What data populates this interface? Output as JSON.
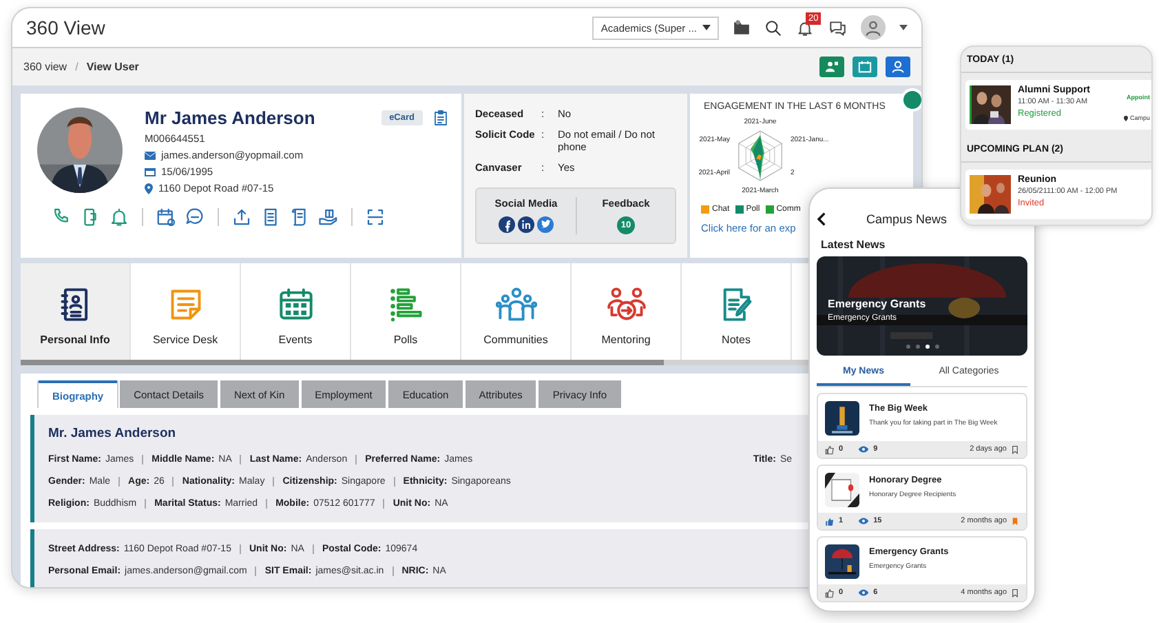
{
  "window": {
    "title": "360 View"
  },
  "header": {
    "role_select": "Academics (Super ...",
    "notification_count": "20"
  },
  "breadcrumb": {
    "items": [
      "360 view",
      "View User"
    ],
    "separator": "/"
  },
  "profile": {
    "name": "Mr James Anderson",
    "id": "M006644551",
    "email": "james.anderson@yopmail.com",
    "dob": "15/06/1995",
    "address": "1160 Depot Road #07-15",
    "ecard": "eCard"
  },
  "status_fields": [
    {
      "label": "Deceased",
      "sep": ":",
      "value": "No"
    },
    {
      "label": "Solicit Code",
      "sep": ":",
      "value": "Do not email / Do not phone"
    },
    {
      "label": "Canvaser",
      "sep": ":",
      "value": "Yes"
    }
  ],
  "social": {
    "title": "Social Media"
  },
  "feedback": {
    "title": "Feedback",
    "count": "10"
  },
  "engagement": {
    "title": "ENGAGEMENT IN THE LAST 6 MONTHS",
    "axes": [
      "2021-June",
      "2021-Janu...",
      "2",
      "2021-March",
      "2021-April",
      "2021-May"
    ],
    "legend": [
      {
        "label": "Chat",
        "color": "#f39c12"
      },
      {
        "label": "Poll",
        "color": "#148a68"
      },
      {
        "label": "Comm",
        "color": "#23a23a"
      }
    ],
    "link": "Click here for an exp"
  },
  "modules": [
    {
      "label": "Personal Info",
      "selected": true
    },
    {
      "label": "Service Desk",
      "selected": false
    },
    {
      "label": "Events",
      "selected": false
    },
    {
      "label": "Polls",
      "selected": false
    },
    {
      "label": "Communities",
      "selected": false
    },
    {
      "label": "Mentoring",
      "selected": false
    },
    {
      "label": "Notes",
      "selected": false
    }
  ],
  "tabs": [
    {
      "label": "Biography",
      "selected": true
    },
    {
      "label": "Contact Details",
      "selected": false
    },
    {
      "label": "Next of Kin",
      "selected": false
    },
    {
      "label": "Employment",
      "selected": false
    },
    {
      "label": "Education",
      "selected": false
    },
    {
      "label": "Attributes",
      "selected": false
    },
    {
      "label": "Privacy Info",
      "selected": false
    }
  ],
  "biography": {
    "heading": "Mr. James Anderson",
    "rows": [
      [
        {
          "label": "First Name:",
          "value": "James"
        },
        {
          "label": "Middle Name:",
          "value": "NA"
        },
        {
          "label": "Last Name:",
          "value": "Anderson"
        },
        {
          "label": "Preferred Name:",
          "value": "James"
        }
      ],
      [
        {
          "label": "Gender:",
          "value": "Male"
        },
        {
          "label": "Age:",
          "value": "26"
        },
        {
          "label": "Nationality:",
          "value": "Malay"
        },
        {
          "label": "Citizenship:",
          "value": "Singapore"
        },
        {
          "label": "Ethnicity:",
          "value": "Singaporeans"
        }
      ],
      [
        {
          "label": "Religion:",
          "value": "Buddhism"
        },
        {
          "label": "Marital Status:",
          "value": "Married"
        },
        {
          "label": "Mobile:",
          "value": "07512 601777"
        },
        {
          "label": "Unit No:",
          "value": "NA"
        }
      ]
    ],
    "aside": {
      "label": "Title:",
      "value": "Se"
    }
  },
  "address": {
    "rows": [
      [
        {
          "label": "Street Address:",
          "value": "1160 Depot Road #07-15"
        },
        {
          "label": "Unit No:",
          "value": "NA"
        },
        {
          "label": "Postal Code:",
          "value": "109674"
        }
      ],
      [
        {
          "label": "Personal Email:",
          "value": "james.anderson@gmail.com"
        },
        {
          "label": "SIT Email:",
          "value": "james@sit.ac.in"
        },
        {
          "label": "NRIC:",
          "value": "NA"
        }
      ]
    ]
  },
  "schedule": [
    {
      "title": "TODAY (1)",
      "items": [
        {
          "title": "Alumni Support",
          "time": "11:00 AM - 11:30 AM",
          "status": "Registered",
          "kind": "registered",
          "type": "Appoint",
          "location": "Campu"
        }
      ]
    },
    {
      "title": "UPCOMING PLAN (2)",
      "items": [
        {
          "title": "Reunion",
          "time": "26/05/2111:00 AM - 12:00 PM",
          "status": "Invited",
          "kind": "invited"
        }
      ]
    }
  ],
  "phone": {
    "title": "Campus News",
    "section": "Latest News",
    "banner": {
      "title": "Emergency Grants",
      "subtitle": "Emergency Grants"
    },
    "slides": [
      {
        "selected": false
      },
      {
        "selected": false
      },
      {
        "selected": true
      },
      {
        "selected": false
      }
    ],
    "tabs": [
      {
        "label": "My News",
        "selected": true
      },
      {
        "label": "All Categories",
        "selected": false
      }
    ],
    "news": [
      {
        "title": "The Big Week",
        "summary": "Thank you for taking part in The Big Week",
        "likes": "0",
        "liked": false,
        "views": "9",
        "age": "2 days ago",
        "bookmarked": false
      },
      {
        "title": "Honorary Degree",
        "summary": "Honorary Degree Recipients",
        "likes": "1",
        "liked": true,
        "views": "15",
        "age": "2 months ago",
        "bookmarked": true
      },
      {
        "title": "Emergency Grants",
        "summary": "Emergency Grants",
        "likes": "0",
        "liked": false,
        "views": "6",
        "age": "4 months ago",
        "bookmarked": false
      }
    ]
  }
}
